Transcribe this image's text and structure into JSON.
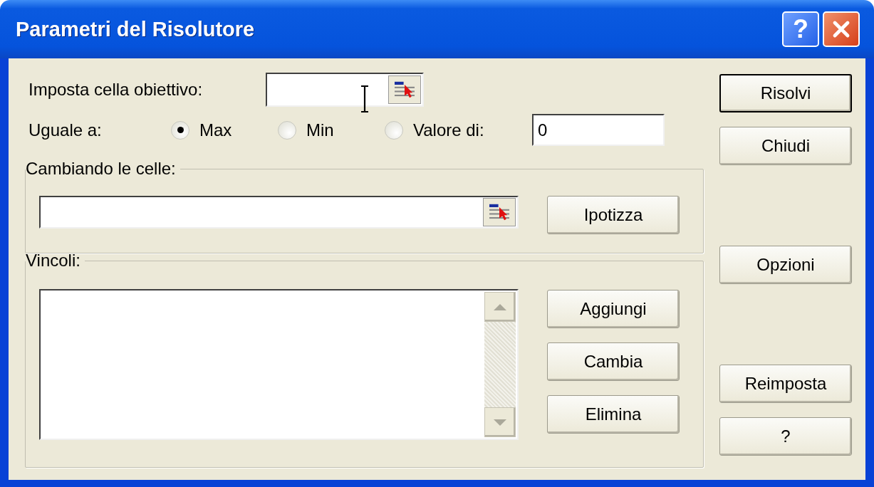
{
  "window": {
    "title": "Parametri del Risolutore",
    "buttons": [
      {
        "kind": "help",
        "label": "?"
      },
      {
        "kind": "close"
      }
    ]
  },
  "target": {
    "label": "Imposta cella obiettivo:"
  },
  "equal_to": {
    "label": "Uguale a:",
    "options": [
      {
        "label": "Max",
        "selected": true
      },
      {
        "label": "Min",
        "selected": false
      },
      {
        "label": "Valore di:",
        "selected": false
      }
    ],
    "value": "0"
  },
  "changing_cells": {
    "label": "Cambiando le celle:",
    "button": {
      "label": "Ipotizza"
    }
  },
  "constraints": {
    "label": "Vincoli:",
    "buttons": [
      {
        "label": "Aggiungi"
      },
      {
        "label": "Cambia"
      },
      {
        "label": "Elimina"
      }
    ]
  },
  "side_buttons": [
    {
      "label": "Risolvi",
      "default": true
    },
    {
      "label": "Chiudi",
      "default": false
    },
    {
      "label": "Opzioni",
      "default": false
    },
    {
      "label": "Reimposta",
      "default": false
    },
    {
      "label": "?",
      "default": false
    }
  ]
}
